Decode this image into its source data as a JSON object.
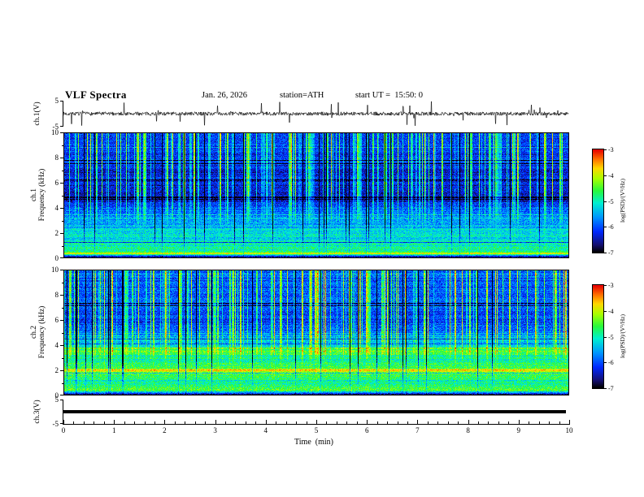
{
  "header": {
    "title": "VLF Spectra",
    "date": "Jan. 26, 2026",
    "station": "station=ATH",
    "start_ut": "start UT =  15:50: 0"
  },
  "labels": {
    "ch1_wave": "ch.1(V)",
    "ch1_spec_line1": "ch.1",
    "ch1_spec_line2": "Frequency (kHz)",
    "ch2_spec_line1": "ch.2",
    "ch2_spec_line2": "Frequency (kHz)",
    "ch3_wave": "ch.3(V)"
  },
  "axes": {
    "x": {
      "label": "Time  (min)",
      "ticks": [
        "0",
        "1",
        "2",
        "3",
        "4",
        "5",
        "6",
        "7",
        "8",
        "9",
        "10"
      ],
      "range": [
        0,
        10
      ]
    },
    "wave_y": {
      "ticks": [
        "5",
        "-5"
      ],
      "range": [
        -5,
        5
      ]
    },
    "spec_y": {
      "ticks": [
        "10",
        "8",
        "6",
        "4",
        "2",
        "0"
      ],
      "range": [
        0,
        10
      ]
    },
    "colorbar": {
      "label": "log(PSD)/(V²/Hz)",
      "ticks": [
        "-3",
        "-4",
        "-5",
        "-6",
        "-7"
      ],
      "range": [
        -7,
        -3
      ]
    }
  },
  "chart_data": [
    {
      "type": "line",
      "name": "ch1-waveform",
      "ylabel": "ch.1(V)",
      "xlim": [
        0,
        10
      ],
      "ylim": [
        -5,
        5
      ],
      "seed": 7,
      "noise_v": 0.7,
      "spike_probability": 0.035,
      "spike_vmax": 4.8,
      "description": "broadband noise near 0 V with frequent impulsive spikes spanning nearly ±5 V over the full 10 minutes"
    },
    {
      "type": "heatmap",
      "name": "ch1-spectrogram",
      "xlim": [
        0,
        10
      ],
      "xlabel": "Time (min)",
      "ylim": [
        0,
        10
      ],
      "ylabel": "ch.1 Frequency (kHz)",
      "zlabel": "log(PSD)/(V²/Hz)",
      "zlim": [
        -7,
        -3
      ],
      "seed": 11,
      "noise": 0.4,
      "bright_streak_density": 0.24,
      "dark_streak_density": 0.05,
      "profile": [
        [
          0,
          -6.7
        ],
        [
          0.12,
          -6.4
        ],
        [
          0.3,
          -4.35
        ],
        [
          0.55,
          -4.8
        ],
        [
          1,
          -5.05
        ],
        [
          1.6,
          -5.2
        ],
        [
          2.6,
          -5.45
        ],
        [
          3.6,
          -5.75
        ],
        [
          4.5,
          -6.3
        ],
        [
          5.5,
          -6.45
        ],
        [
          6.8,
          -6.3
        ],
        [
          7.5,
          -6.15
        ],
        [
          10,
          -6.1
        ]
      ],
      "lines": [
        [
          0.35,
          -4.1,
          0.05
        ]
      ],
      "description": "green/cyan bands below ~4 kHz, dark-blue background 4.5–7 kHz, dense bright vertical sferic streaks dominating 6–10 kHz, black band near 0 kHz"
    },
    {
      "type": "heatmap",
      "name": "ch2-spectrogram",
      "xlim": [
        0,
        10
      ],
      "xlabel": "Time (min)",
      "ylim": [
        0,
        10
      ],
      "ylabel": "ch.2 Frequency (kHz)",
      "zlabel": "log(PSD)/(V²/Hz)",
      "zlim": [
        -7,
        -3
      ],
      "seed": 23,
      "noise": 0.42,
      "bright_streak_density": 0.2,
      "dark_streak_density": 0.04,
      "profile": [
        [
          0,
          -6.7
        ],
        [
          0.12,
          -6.3
        ],
        [
          0.35,
          -4.5
        ],
        [
          0.7,
          -4.8
        ],
        [
          1.2,
          -4.95
        ],
        [
          1.8,
          -4.4
        ],
        [
          2.0,
          -4.1
        ],
        [
          2.3,
          -4.75
        ],
        [
          3.0,
          -4.95
        ],
        [
          3.55,
          -4.55
        ],
        [
          4.0,
          -5.2
        ],
        [
          4.8,
          -5.5
        ],
        [
          5.4,
          -5.95
        ],
        [
          6.0,
          -6.2
        ],
        [
          6.6,
          -6.15
        ],
        [
          7.2,
          -6.0
        ],
        [
          8,
          -5.95
        ],
        [
          10,
          -5.9
        ]
      ],
      "lines": [
        [
          1.95,
          -3.9,
          0.1
        ],
        [
          3.55,
          -4.45,
          0.08
        ]
      ],
      "description": "bright yellow/orange line near 2 kHz, secondary bright band near 3.6 kHz, green lower half, dark-blue 5.5–6.6 kHz, blue upper region with green vertical streaks"
    },
    {
      "type": "line",
      "name": "ch3-waveform",
      "ylabel": "ch.3(V)",
      "xlim": [
        0,
        10
      ],
      "ylim": [
        -5,
        5
      ],
      "seed": 5,
      "value": 0,
      "description": "constant thick flat trace at 0 V for the full record"
    }
  ]
}
